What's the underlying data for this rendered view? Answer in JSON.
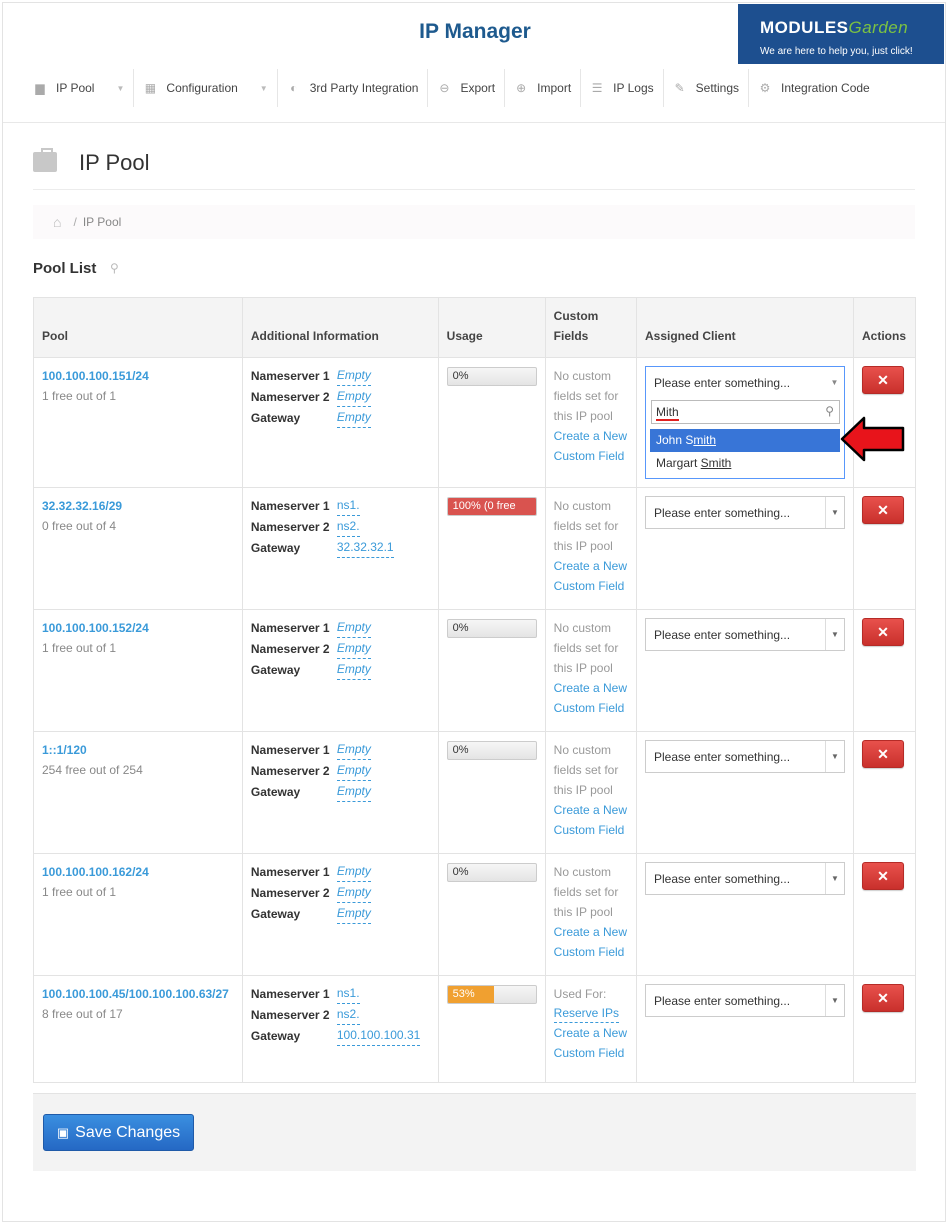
{
  "app": {
    "title": "IP Manager"
  },
  "brand": {
    "name_a": "MODULES",
    "name_b": "Garden",
    "tagline": "We are here to help you, just click!"
  },
  "nav": [
    {
      "label": "IP Pool",
      "icon": "briefcase-icon",
      "glyph": "▆",
      "caret": true
    },
    {
      "label": "Configuration",
      "icon": "grid-icon",
      "glyph": "▦",
      "caret": true
    },
    {
      "label": "3rd Party Integration",
      "icon": "users-icon",
      "glyph": "◐",
      "caret": false
    },
    {
      "label": "Export",
      "icon": "export-icon",
      "glyph": "⊖",
      "caret": false
    },
    {
      "label": "Import",
      "icon": "import-icon",
      "glyph": "⊕",
      "caret": false
    },
    {
      "label": "IP Logs",
      "icon": "list-icon",
      "glyph": "☰",
      "caret": false
    },
    {
      "label": "Settings",
      "icon": "wrench-icon",
      "glyph": "✎",
      "caret": false
    },
    {
      "label": "Integration Code",
      "icon": "cogs-icon",
      "glyph": "⚙",
      "caret": false
    }
  ],
  "page": {
    "title": "IP Pool"
  },
  "breadcrumb": {
    "current": "IP Pool"
  },
  "section": {
    "title": "Pool List"
  },
  "table": {
    "headers": {
      "pool": "Pool",
      "info": "Additional Information",
      "usage": "Usage",
      "custom_a": "Custom",
      "custom_b": "Fields",
      "client": "Assigned Client",
      "actions": "Actions"
    },
    "labels": {
      "ns1": "Nameserver 1",
      "ns2": "Nameserver 2",
      "gw": "Gateway"
    },
    "rows": [
      {
        "pool": "100.100.100.151/24",
        "free": "1 free out of 1",
        "ns1": "Empty",
        "ns2": "Empty",
        "gw": "Empty",
        "empty": [
          true,
          true,
          true
        ],
        "usage_text": "0%",
        "usage_pct": 0,
        "usage_color": "none",
        "custom": [
          "No custom",
          "fields set for",
          "this IP pool"
        ],
        "links": [
          "Create a New",
          "Custom Field"
        ],
        "client_placeholder": "Please enter something..."
      },
      {
        "pool": "32.32.32.16/29",
        "free": "0 free out of 4",
        "ns1": "ns1.",
        "ns2": "ns2.",
        "gw": "32.32.32.1",
        "empty": [
          false,
          false,
          false
        ],
        "usage_text": "100% (0 free",
        "usage_pct": 100,
        "usage_color": "red",
        "custom": [
          "No custom",
          "fields set for",
          "this IP pool"
        ],
        "links": [
          "Create a New",
          "Custom Field"
        ],
        "client_placeholder": "Please enter something..."
      },
      {
        "pool": "100.100.100.152/24",
        "free": "1 free out of 1",
        "ns1": "Empty",
        "ns2": "Empty",
        "gw": "Empty",
        "empty": [
          true,
          true,
          true
        ],
        "usage_text": "0%",
        "usage_pct": 0,
        "usage_color": "none",
        "custom": [
          "No custom",
          "fields set for",
          "this IP pool"
        ],
        "links": [
          "Create a New",
          "Custom Field"
        ],
        "client_placeholder": "Please enter something..."
      },
      {
        "pool": "1::1/120",
        "free": "254 free out of 254",
        "ns1": "Empty",
        "ns2": "Empty",
        "gw": "Empty",
        "empty": [
          true,
          true,
          true
        ],
        "usage_text": "0%",
        "usage_pct": 0,
        "usage_color": "none",
        "custom": [
          "No custom",
          "fields set for",
          "this IP pool"
        ],
        "links": [
          "Create a New",
          "Custom Field"
        ],
        "client_placeholder": "Please enter something..."
      },
      {
        "pool": "100.100.100.162/24",
        "free": "1 free out of 1",
        "ns1": "Empty",
        "ns2": "Empty",
        "gw": "Empty",
        "empty": [
          true,
          true,
          true
        ],
        "usage_text": "0%",
        "usage_pct": 0,
        "usage_color": "none",
        "custom": [
          "No custom",
          "fields set for",
          "this IP pool"
        ],
        "links": [
          "Create a New",
          "Custom Field"
        ],
        "client_placeholder": "Please enter something..."
      },
      {
        "pool": "100.100.100.45/100.100.100.63/27",
        "free": "8 free out of 17",
        "ns1": "ns1.",
        "ns2": "ns2.",
        "gw": "100.100.100.31",
        "empty": [
          false,
          false,
          false
        ],
        "usage_text": "53%",
        "usage_pct": 53,
        "usage_color": "orange",
        "custom": [
          "Used For:"
        ],
        "used_link": "Reserve IPs",
        "links": [
          "Create a New",
          "Custom Field"
        ],
        "client_placeholder": "Please enter something..."
      }
    ]
  },
  "dropdown": {
    "search_value": "Mith",
    "options": [
      {
        "pre": "John S",
        "match": "mith",
        "selected": true
      },
      {
        "pre": "Margart ",
        "match": "Smith",
        "selected": false
      }
    ]
  },
  "delete_glyph": "✕",
  "footer": {
    "save_label": "Save Changes"
  },
  "colors": {
    "accent": "#3a9ad9",
    "title": "#1e5a8e",
    "danger": "#d9534f",
    "warning": "#f0a030",
    "primary": "#2568c4"
  }
}
